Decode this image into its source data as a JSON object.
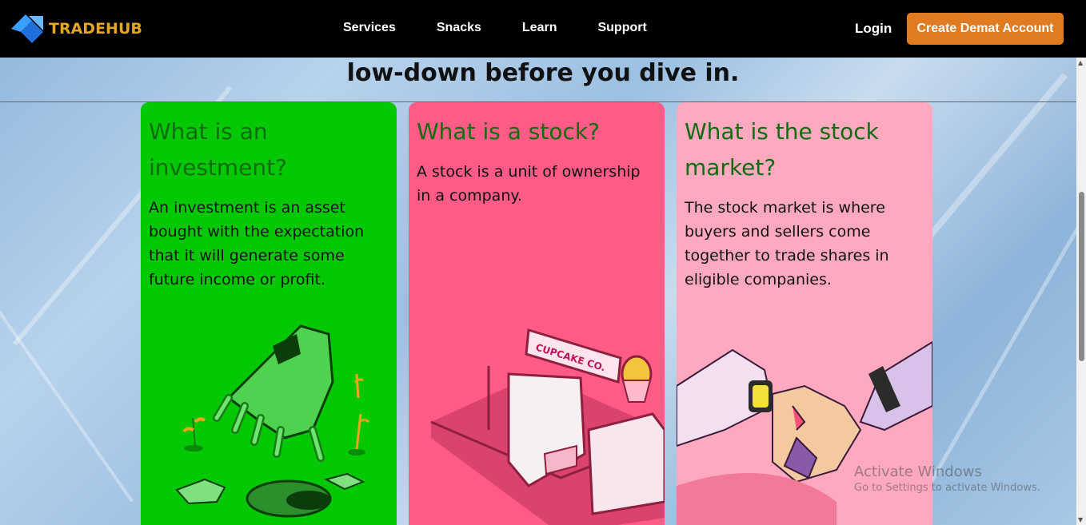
{
  "header": {
    "brand": "TRADEHUB",
    "nav": [
      "Services",
      "Snacks",
      "Learn",
      "Support"
    ],
    "login": "Login",
    "cta": "Create Demat Account"
  },
  "section": {
    "heading": "low-down before you dive in."
  },
  "cards": [
    {
      "title": "What is an investment?",
      "text": "An investment is an asset bought with the expectation that it will generate some future income or profit.",
      "color": "#05c805",
      "illustration": "robot-hand-planting-icon"
    },
    {
      "title": "What is a stock?",
      "text": "A stock is a unit of ownership in a company.",
      "color": "#fe5c86",
      "illustration": "cupcake-shop-icon",
      "shop_sign": "CUPCAKE CO."
    },
    {
      "title": "What is the stock market?",
      "text": "The stock market is where buyers and sellers come together to trade shares in eligible companies.",
      "color": "#fea9c0",
      "illustration": "handshake-icon"
    }
  ],
  "watermark": {
    "title": "Activate Windows",
    "subtitle": "Go to Settings to activate Windows."
  },
  "colors": {
    "brand": "#e4a521",
    "cta": "#e07b22",
    "card_title": "#0f6d0f"
  }
}
